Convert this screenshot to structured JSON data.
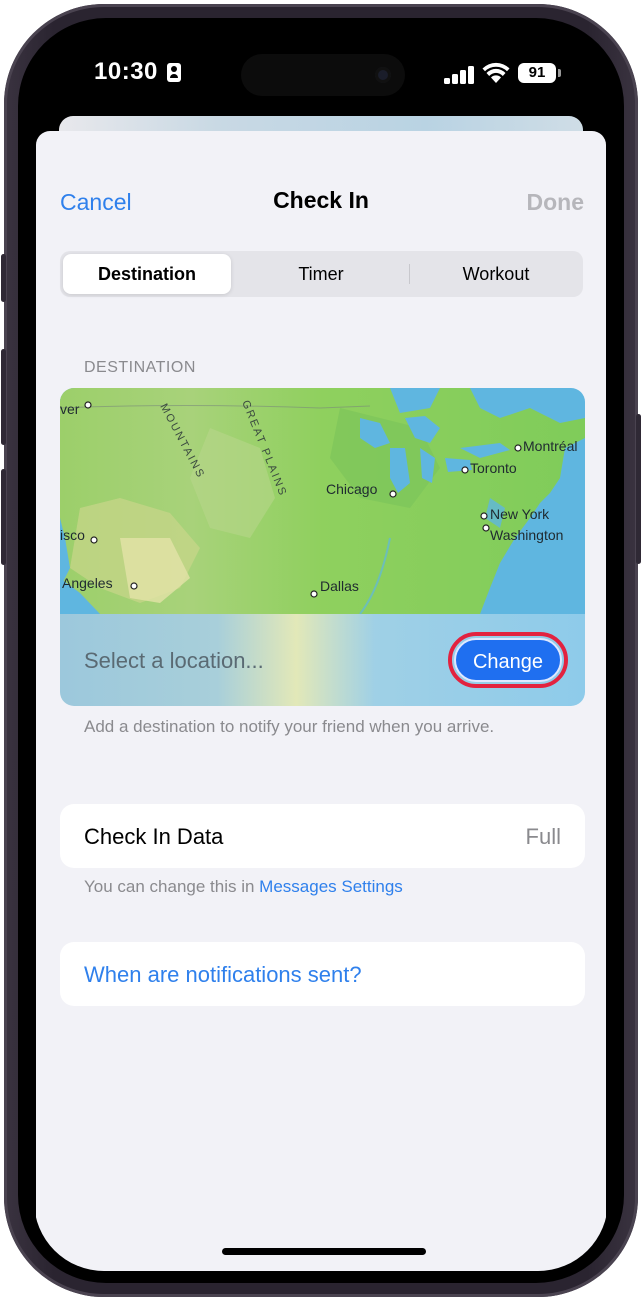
{
  "status_bar": {
    "time": "10:30",
    "battery": "91"
  },
  "nav": {
    "cancel": "Cancel",
    "title": "Check In",
    "done": "Done"
  },
  "segments": [
    {
      "label": "Destination"
    },
    {
      "label": "Timer"
    },
    {
      "label": "Workout"
    }
  ],
  "destination": {
    "section_label": "DESTINATION",
    "placeholder": "Select a location...",
    "change_label": "Change",
    "helper": "Add a destination to notify your friend when you arrive."
  },
  "map": {
    "cities": [
      {
        "label": "ver"
      },
      {
        "label": "Montréal"
      },
      {
        "label": "Toronto"
      },
      {
        "label": "Chicago"
      },
      {
        "label": "New York"
      },
      {
        "label": "isco"
      },
      {
        "label": "Washington"
      },
      {
        "label": "Angeles"
      },
      {
        "label": "Dallas"
      }
    ],
    "regions": [
      {
        "label": "MOUNTAINS"
      },
      {
        "label": "GREAT PLAINS"
      }
    ]
  },
  "check_in_data": {
    "label": "Check In Data",
    "value": "Full"
  },
  "settings_note": {
    "text": "You can change this in ",
    "link": "Messages Settings"
  },
  "notifications_link": "When are notifications sent?"
}
